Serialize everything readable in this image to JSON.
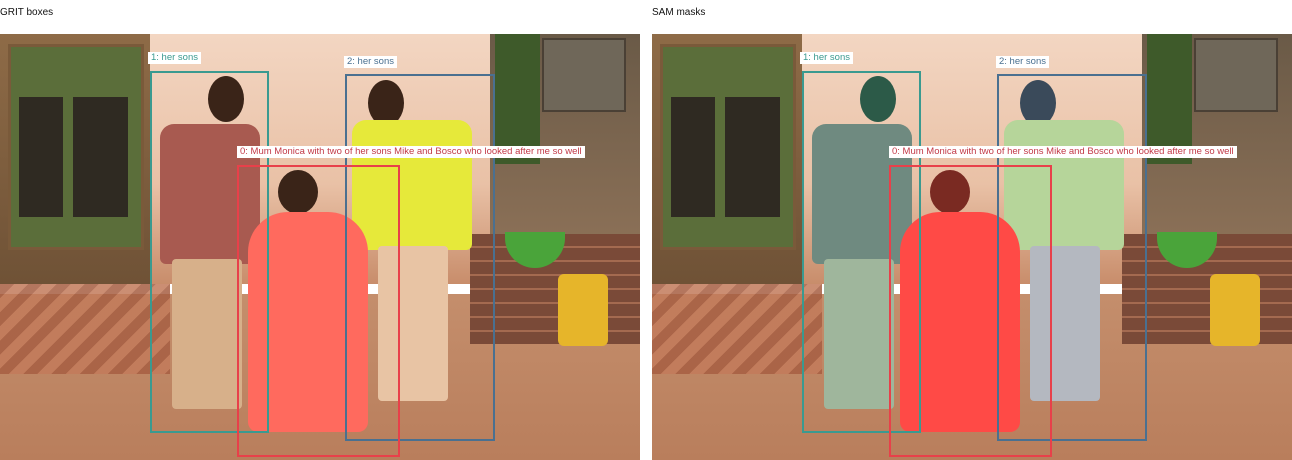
{
  "panels": {
    "left_title": "GRIT boxes",
    "right_title": "SAM masks"
  },
  "annotations": [
    {
      "index": "0",
      "text": "0: Mum Monica with two of her sons Mike and Bosco who looked after me so well",
      "color": "#e8404a"
    },
    {
      "index": "1",
      "text": "1: her sons",
      "color": "#3a9a90"
    },
    {
      "index": "2",
      "text": "2: her sons",
      "color": "#4a7090"
    }
  ],
  "mask_colors": {
    "person_left": "#5aa6a0",
    "person_right": "#8fb8d8",
    "person_mother": "#ff5a5a"
  }
}
